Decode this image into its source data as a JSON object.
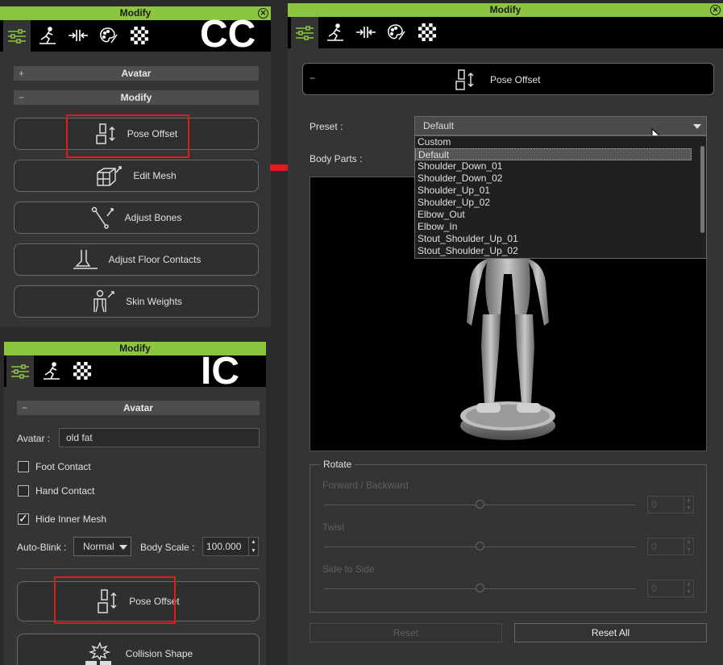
{
  "cc_panel": {
    "title": "Modify",
    "overlay_label": "CC",
    "tabs": [
      {
        "icon": "modify-settings-icon"
      },
      {
        "icon": "motion-pose-icon"
      },
      {
        "icon": "morph-icon"
      },
      {
        "icon": "material-palette-icon"
      },
      {
        "icon": "checker-texture-icon"
      }
    ],
    "sections": [
      {
        "sign": "+",
        "label": "Avatar"
      },
      {
        "sign": "−",
        "label": "Modify"
      }
    ],
    "tools": [
      {
        "label": "Pose Offset",
        "icon": "pose-offset-icon"
      },
      {
        "label": "Edit Mesh",
        "icon": "edit-mesh-icon"
      },
      {
        "label": "Adjust Bones",
        "icon": "adjust-bones-icon"
      },
      {
        "label": "Adjust Floor Contacts",
        "icon": "floor-contacts-icon"
      },
      {
        "label": "Skin Weights",
        "icon": "skin-weights-icon"
      }
    ]
  },
  "ic_panel": {
    "title": "Modify",
    "overlay_label": "IC",
    "section": {
      "sign": "−",
      "label": "Avatar"
    },
    "avatar_label": "Avatar :",
    "avatar_value": "old fat",
    "checkboxes": [
      {
        "label": "Foot Contact",
        "checked": false
      },
      {
        "label": "Hand Contact",
        "checked": false
      },
      {
        "label": "Hide Inner Mesh",
        "checked": true
      }
    ],
    "auto_blink_label": "Auto-Blink :",
    "auto_blink_value": "Normal",
    "body_scale_label": "Body Scale :",
    "body_scale_value": "100.000",
    "tools": [
      {
        "label": "Pose Offset",
        "icon": "pose-offset-icon"
      },
      {
        "label": "Collision Shape",
        "icon": "collision-shape-icon"
      }
    ]
  },
  "main_panel": {
    "title": "Modify",
    "header_sign": "−",
    "header_label": "Pose Offset",
    "preset_label": "Preset :",
    "preset_value": "Default",
    "body_parts_label": "Body Parts :",
    "preset_options": [
      "Custom",
      "Default",
      "Shoulder_Down_01",
      "Shoulder_Down_02",
      "Shoulder_Up_01",
      "Shoulder_Up_02",
      "Elbow_Out",
      "Elbow_In",
      "Stout_Shoulder_Up_01",
      "Stout_Shoulder_Up_02"
    ],
    "preset_selected_index": 1,
    "rotate": {
      "title": "Rotate",
      "sliders": [
        {
          "label": "Forward / Backward",
          "value": "0",
          "level": 0.5
        },
        {
          "label": "Twist",
          "value": "0",
          "level": 0.5
        },
        {
          "label": "Side to Side",
          "value": "0",
          "level": 0.5
        }
      ]
    },
    "reset_label": "Reset",
    "reset_all_label": "Reset All"
  },
  "colors": {
    "accent": "#8cc63f",
    "highlight": "#e01b1b",
    "arrow": "#e01b1b"
  }
}
